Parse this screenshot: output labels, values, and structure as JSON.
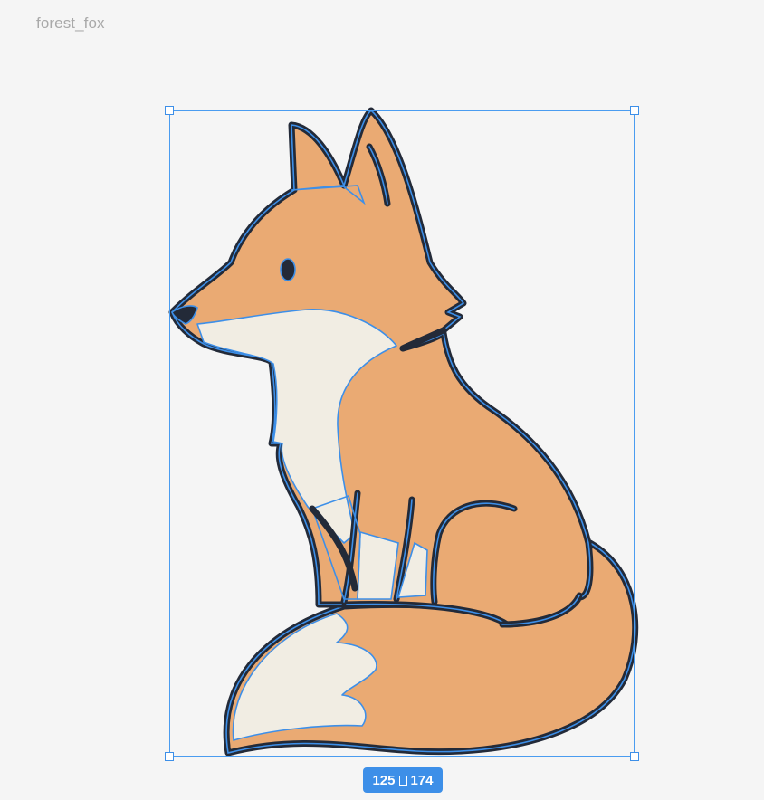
{
  "frame": {
    "name": "forest_fox"
  },
  "selection": {
    "width": "125",
    "height": "174"
  },
  "colors": {
    "fur": "#eaaa73",
    "cream": "#f1ede3",
    "outline": "#232a38",
    "selection": "#3d8fe8",
    "canvas": "#f5f5f5"
  }
}
